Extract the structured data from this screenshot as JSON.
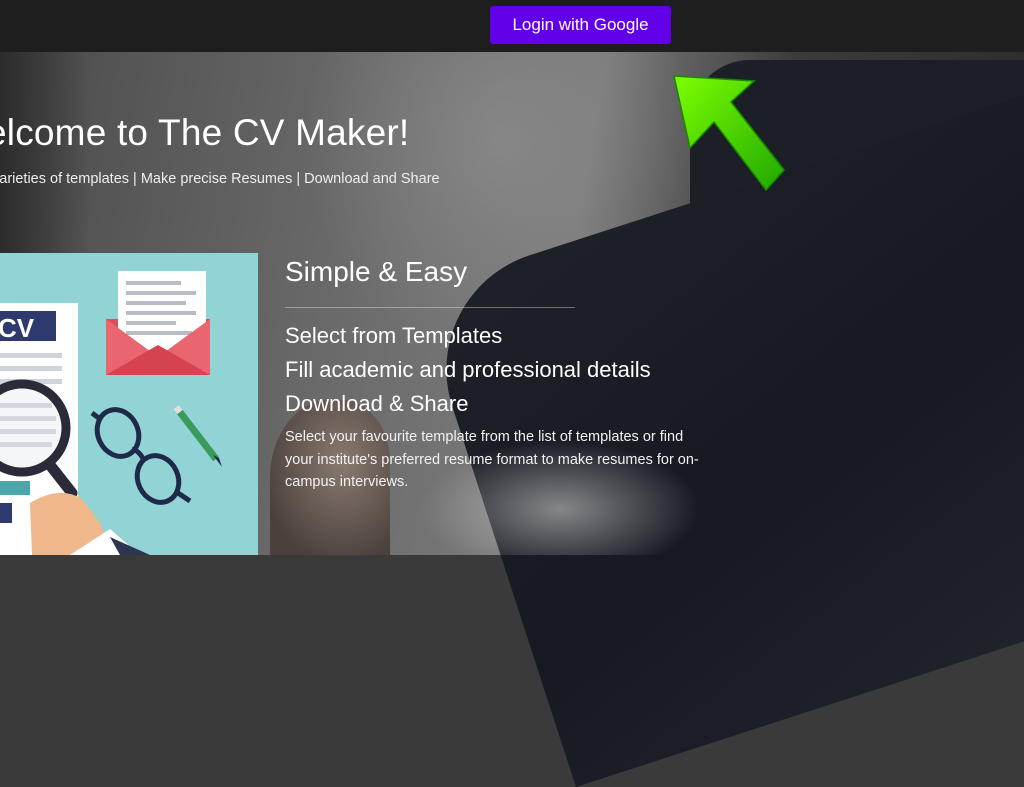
{
  "topbar": {
    "login_label": "Login with Google"
  },
  "hero": {
    "title": "elcome to The CV Maker!",
    "subtitle": "varieties of templates | Make precise Resumes | Download and Share"
  },
  "illustration": {
    "badge_text": "CV"
  },
  "feature": {
    "heading": "Simple & Easy",
    "items": [
      "Select from Templates",
      "Fill academic and professional details",
      "Download & Share"
    ],
    "description": "Select your favourite template from the list of templates or find your institute's preferred resume format to make resumes for on-campus interviews."
  },
  "colors": {
    "accent": "#6200ea",
    "arrow": "#55e000",
    "illustration_bg": "#92d3d6"
  },
  "icons": {
    "arrow": "arrow-up-left-icon",
    "envelope": "envelope-icon",
    "magnifier": "magnifying-glass-icon",
    "glasses": "eyeglasses-icon",
    "pencil": "pencil-icon"
  }
}
